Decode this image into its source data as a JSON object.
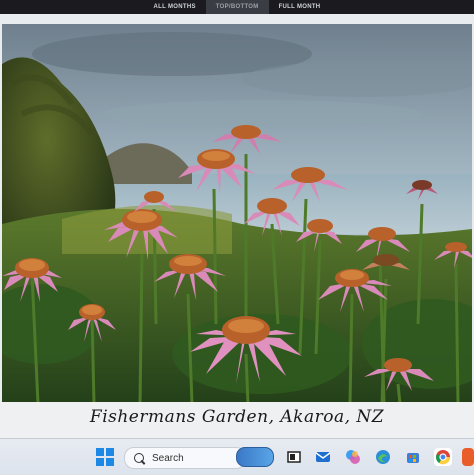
{
  "tabs": [
    {
      "label": "ALL MONTHS"
    },
    {
      "label": "TOP/BOTTOM"
    },
    {
      "label": "FULL MONTH"
    }
  ],
  "caption": "Fishermans Garden, Akaroa, NZ",
  "taskbar": {
    "search_placeholder": "Search",
    "icons": [
      "windows-start-icon",
      "search-icon",
      "search-highlight-icon",
      "task-view-icon",
      "mail-icon",
      "copilot-icon",
      "edge-icon",
      "store-icon",
      "photos-icon",
      "chrome-icon"
    ]
  },
  "colors": {
    "accent": "#1e88e5",
    "petal": "#d88ab8",
    "cone": "#c9782e"
  }
}
